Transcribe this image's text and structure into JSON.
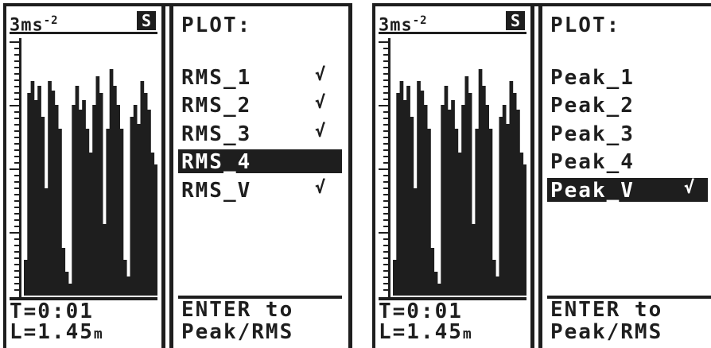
{
  "screens": [
    {
      "scale_label": "3ms",
      "scale_exp": "-2",
      "mode_icon": "S",
      "menu_title": "PLOT:",
      "items": [
        {
          "label": "RMS_1",
          "checked": true,
          "selected": false
        },
        {
          "label": "RMS_2",
          "checked": true,
          "selected": false
        },
        {
          "label": "RMS_3",
          "checked": true,
          "selected": false
        },
        {
          "label": "RMS_4",
          "checked": false,
          "selected": true
        },
        {
          "label": "RMS_V",
          "checked": true,
          "selected": false
        }
      ],
      "time": "T=0:01",
      "level": "L=1.45",
      "level_unit": "m",
      "hint_line1": "ENTER to",
      "hint_line2": "Peak/RMS"
    },
    {
      "scale_label": "3ms",
      "scale_exp": "-2",
      "mode_icon": "S",
      "menu_title": "PLOT:",
      "items": [
        {
          "label": "Peak_1",
          "checked": false,
          "selected": false
        },
        {
          "label": "Peak_2",
          "checked": false,
          "selected": false
        },
        {
          "label": "Peak_3",
          "checked": false,
          "selected": false
        },
        {
          "label": "Peak_4",
          "checked": false,
          "selected": false
        },
        {
          "label": "Peak_V",
          "checked": true,
          "selected": true
        }
      ],
      "time": "T=0:01",
      "level": "L=1.45",
      "level_unit": "m",
      "hint_line1": "ENTER to",
      "hint_line2": "Peak/RMS"
    }
  ],
  "checkmark_glyph": "√",
  "spectrum_levels": [
    0.15,
    0.85,
    0.9,
    0.82,
    0.88,
    0.75,
    0.45,
    0.9,
    0.86,
    0.8,
    0.7,
    0.2,
    0.1,
    0.05,
    0.8,
    0.88,
    0.78,
    0.82,
    0.7,
    0.6,
    0.8,
    0.92,
    0.85,
    0.3,
    0.7,
    0.95,
    0.88,
    0.8,
    0.7,
    0.15,
    0.08,
    0.75,
    0.8,
    0.72,
    0.9,
    0.85,
    0.78,
    0.6,
    0.55
  ]
}
